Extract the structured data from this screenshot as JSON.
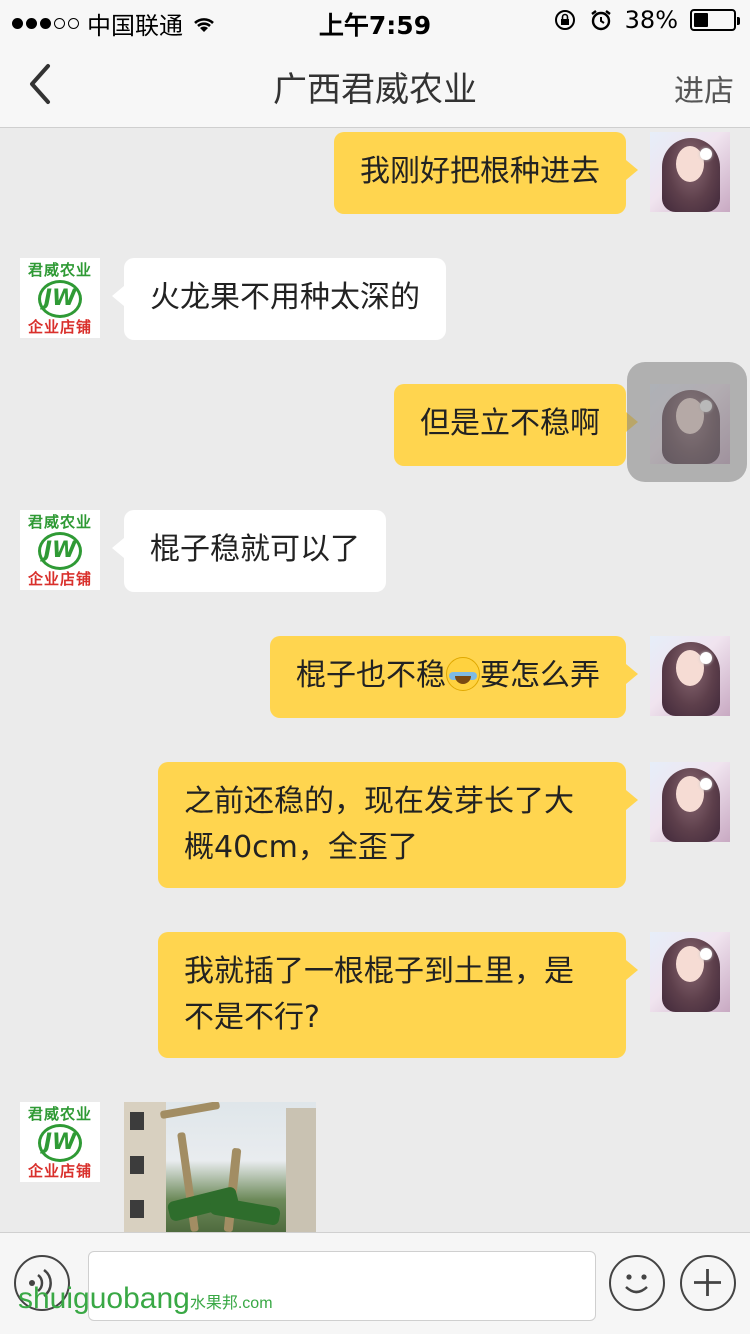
{
  "status": {
    "carrier": "中国联通",
    "time": "上午7:59",
    "battery": "38%",
    "battery_level": 0.38
  },
  "nav": {
    "back_icon": "chevron-left-icon",
    "title": "广西君威农业",
    "action": "进店"
  },
  "shop_avatar": {
    "top_text": "君威农业",
    "logo_text": "JW",
    "bottom_text": "企业店铺"
  },
  "messages": [
    {
      "side": "me",
      "text": "我刚好把根种进去"
    },
    {
      "side": "them",
      "text": "火龙果不用种太深的"
    },
    {
      "side": "me",
      "text": "但是立不稳啊"
    },
    {
      "side": "them",
      "text": "棍子稳就可以了"
    },
    {
      "side": "me",
      "text_before": "棍子也不稳",
      "emoji": "crying-laughing-emoji",
      "text_after": "要怎么弄"
    },
    {
      "side": "me",
      "line1": "之前还稳的，现在发芽长了大",
      "line2": "概40cm，全歪了"
    },
    {
      "side": "me",
      "line1": "我就插了一根棍子到土里，是",
      "line2": "不是不行?"
    },
    {
      "side": "them",
      "type": "image",
      "image": "photo-of-dragon-fruit-stakes"
    }
  ],
  "input": {
    "voice_icon": "voice-icon",
    "emoji_icon": "smiley-icon",
    "plus_icon": "plus-icon",
    "placeholder": ""
  },
  "watermark": {
    "text": "shuiguobang",
    "small": "水果邦",
    "suffix": ".com"
  }
}
